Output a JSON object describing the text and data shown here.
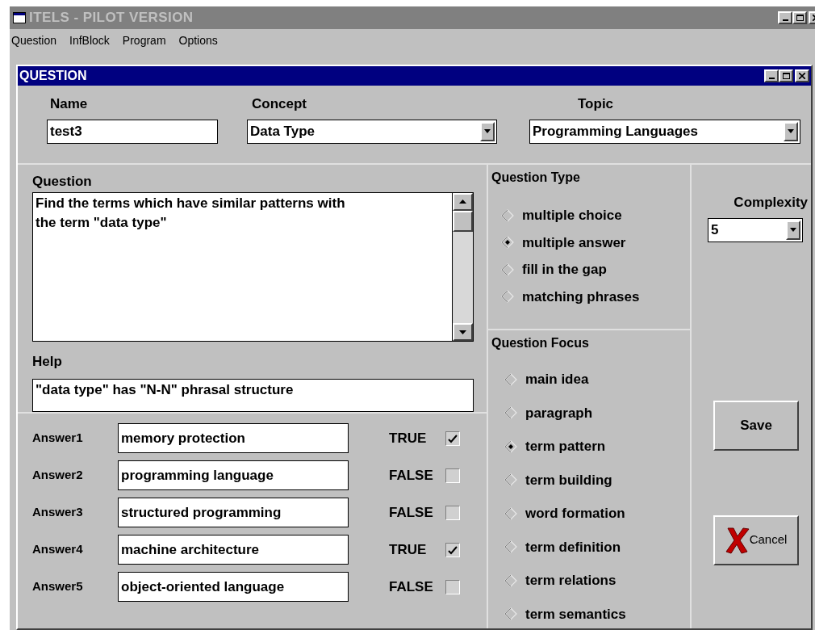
{
  "window": {
    "title": "ITELS - PILOT VERSION"
  },
  "menu": [
    "Question",
    "InfBlock",
    "Program",
    "Options"
  ],
  "dialog": {
    "title": "QUESTION"
  },
  "name": {
    "label": "Name",
    "value": "test3"
  },
  "concept": {
    "label": "Concept",
    "value": "Data Type"
  },
  "topic": {
    "label": "Topic",
    "value": "Programming Languages"
  },
  "question": {
    "label": "Question",
    "value": "Find the terms which have similar patterns with the term \"data type\""
  },
  "help": {
    "label": "Help",
    "value": "\"data type\" has \"N-N\" phrasal structure"
  },
  "answers": [
    {
      "label": "Answer1",
      "value": "memory protection",
      "truth": "TRUE",
      "checked": true
    },
    {
      "label": "Answer2",
      "value": "programming language",
      "truth": "FALSE",
      "checked": false
    },
    {
      "label": "Answer3",
      "value": "structured programming",
      "truth": "FALSE",
      "checked": false
    },
    {
      "label": "Answer4",
      "value": "machine architecture",
      "truth": "TRUE",
      "checked": true
    },
    {
      "label": "Answer5",
      "value": "object-oriented language",
      "truth": "FALSE",
      "checked": false
    }
  ],
  "question_type": {
    "label": "Question Type",
    "options": [
      {
        "label": "multiple choice",
        "selected": false
      },
      {
        "label": "multiple answer",
        "selected": true
      },
      {
        "label": "fill in the gap",
        "selected": false
      },
      {
        "label": "matching phrases",
        "selected": false
      }
    ]
  },
  "question_focus": {
    "label": "Question Focus",
    "options": [
      {
        "label": "main idea",
        "selected": false
      },
      {
        "label": "paragraph",
        "selected": false
      },
      {
        "label": "term pattern",
        "selected": true
      },
      {
        "label": "term building",
        "selected": false
      },
      {
        "label": "word formation",
        "selected": false
      },
      {
        "label": "term definition",
        "selected": false
      },
      {
        "label": "term relations",
        "selected": false
      },
      {
        "label": "term semantics",
        "selected": false
      }
    ]
  },
  "complexity": {
    "label": "Complexity",
    "value": "5"
  },
  "buttons": {
    "save": "Save",
    "cancel": "Cancel"
  }
}
